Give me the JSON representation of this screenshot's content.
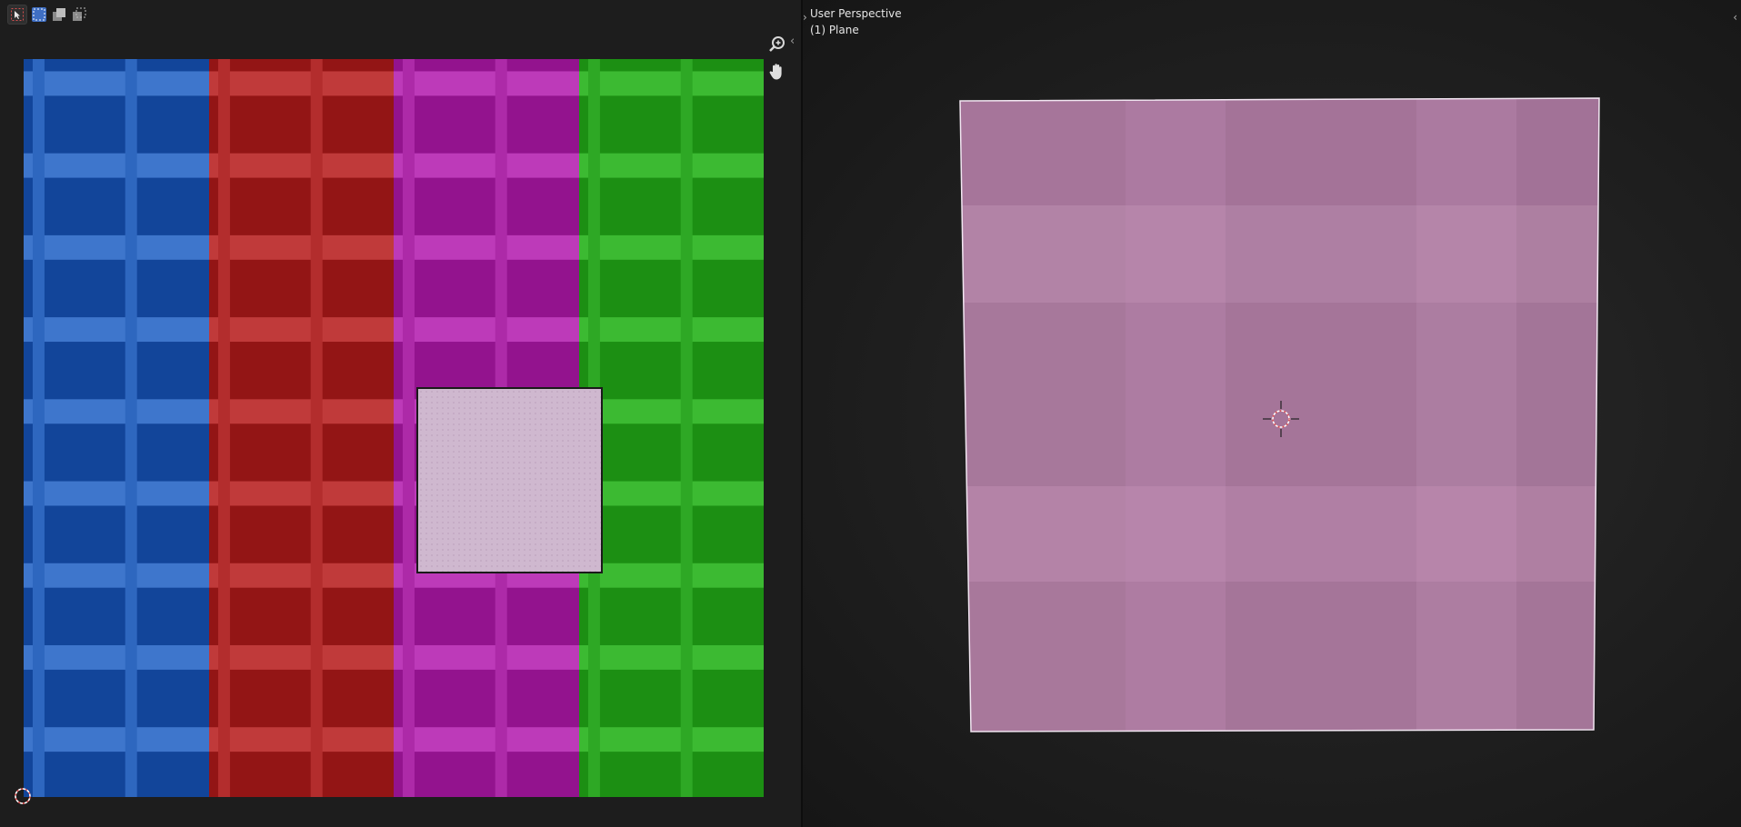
{
  "uv_editor": {
    "tools": {
      "select_icon": "cursor-arrow-icon",
      "select_modes": [
        "select-new-icon",
        "select-extend-icon",
        "select-subtract-icon"
      ]
    },
    "navigation": {
      "zoom_icon": "zoom-in-icon",
      "pan_icon": "hand-pan-icon"
    },
    "texture_columns": [
      {
        "name": "blue",
        "base": "#12459a",
        "light": "#2e67bf",
        "lighter": "#3e76cc"
      },
      {
        "name": "red",
        "base": "#931515",
        "light": "#b32d2d",
        "lighter": "#c03a3a"
      },
      {
        "name": "magenta",
        "base": "#93138e",
        "light": "#ad2aa8",
        "lighter": "#bd3ab9"
      },
      {
        "name": "green",
        "base": "#1c8f13",
        "light": "#2ea825",
        "lighter": "#3cba32"
      }
    ],
    "selection_color": "#cfb8cf"
  },
  "viewport": {
    "perspective_label": "User Perspective",
    "object_label": "(1) Plane",
    "plane_color": "#a8779a",
    "cursor_icon": "3d-cursor-icon"
  }
}
